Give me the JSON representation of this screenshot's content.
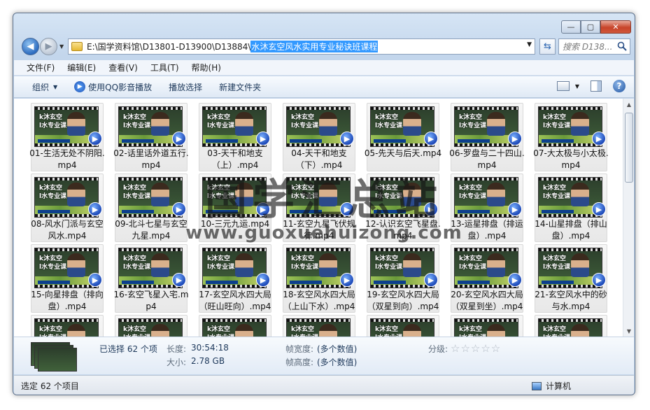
{
  "window": {
    "minimize_glyph": "—",
    "maximize_glyph": "▢",
    "close_glyph": "✕"
  },
  "address": {
    "path_prefix": "E:\\国学资料馆\\D13801-D13900\\D13884",
    "path_selected": "水沐玄空风水实用专业秘诀班课程"
  },
  "search": {
    "placeholder": "搜索 D138..."
  },
  "menu": [
    "文件(F)",
    "编辑(E)",
    "查看(V)",
    "工具(T)",
    "帮助(H)"
  ],
  "toolbar": {
    "organize": "组织",
    "play_qq": "使用QQ影音播放",
    "play_select": "播放选择",
    "new_folder": "新建文件夹"
  },
  "thumb": {
    "line1": "k沐玄空",
    "line2": "l水专业课"
  },
  "files": [
    "01-生活无处不阴阳.mp4",
    "02-话里话外道五行.mp4",
    "03-天干和地支（上）.mp4",
    "04-天干和地支（下）.mp4",
    "05-先天与后天.mp4",
    "06-罗盘与二十四山.mp4",
    "07-大太极与小太极.mp4",
    "08-风水门派与玄空风水.mp4",
    "09-北斗七星与玄空九星.mp4",
    "10-三元九运.mp4",
    "11-玄空九星飞伏规律.mp4",
    "12-认识玄空飞星盘.mp4",
    "13-运星排盘（排运盘）.mp4",
    "14-山星排盘（排山盘）.mp4",
    "15-向星排盘（排向盘）.mp4",
    "16-玄空飞星入宅.mp4",
    "17-玄空风水四大局（旺山旺向）.mp4",
    "18-玄空风水四大局（上山下水）.mp4",
    "19-玄空风水四大局（双星到向）.mp4",
    "20-玄空风水四大局（双星到坐）.mp4",
    "21-玄空风水中的砂与水.mp4"
  ],
  "watermark": {
    "text": "国学汇总站",
    "url": "www.guoxuehuizong.com"
  },
  "details": {
    "selected": "已选择 62 个项",
    "length_label": "长度:",
    "length_value": "30:54:18",
    "size_label": "大小:",
    "size_value": "2.78 GB",
    "width_label": "帧宽度:",
    "width_value": "(多个数值)",
    "height_label": "帧高度:",
    "height_value": "(多个数值)",
    "rating_label": "分级:",
    "rating_value": 0,
    "rating_stars": "☆☆☆☆☆"
  },
  "status": {
    "text": "选定 62 个项目",
    "computer": "计算机"
  }
}
